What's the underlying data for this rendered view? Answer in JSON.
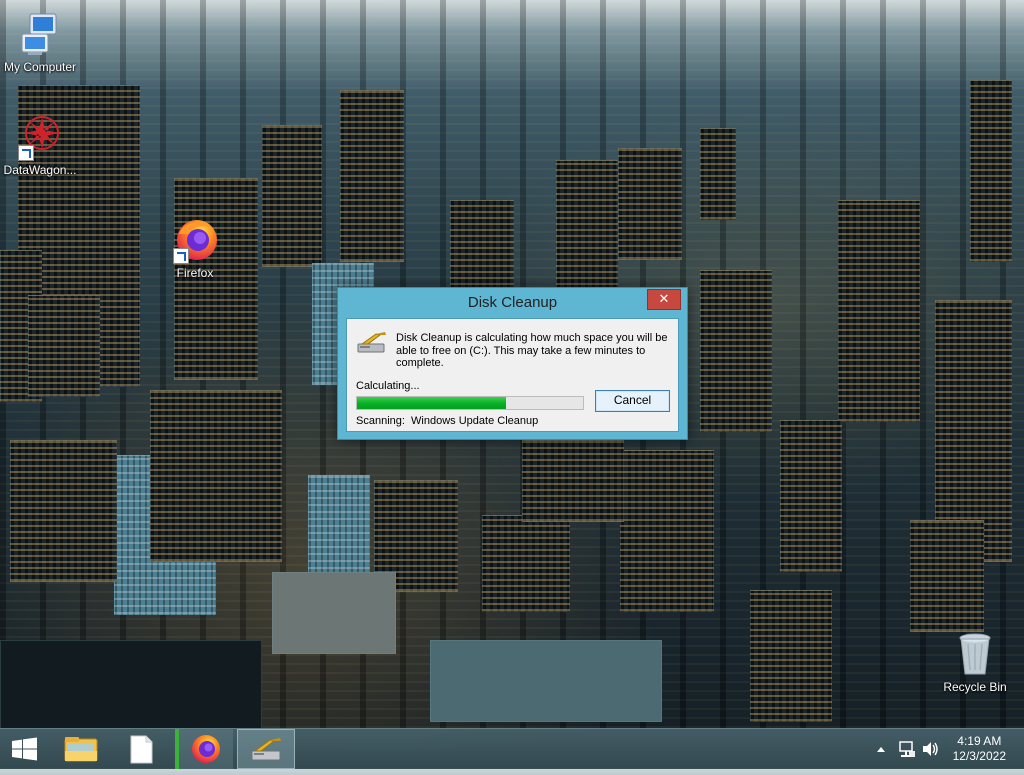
{
  "desktop": {
    "icons": [
      {
        "label": "My Computer"
      },
      {
        "label": "DataWagon..."
      },
      {
        "label": "Firefox"
      },
      {
        "label": "Recycle Bin"
      }
    ]
  },
  "dialog": {
    "title": "Disk Cleanup",
    "close_symbol": "✕",
    "message": "Disk Cleanup is calculating how much space you will be able to free on  (C:). This may take a few minutes to complete.",
    "status_label": "Calculating...",
    "progress_fraction": 0.66,
    "cancel_label": "Cancel",
    "scanning_text": "Scanning:  Windows Update Cleanup"
  },
  "taskbar": {
    "items": [
      {
        "name": "start-button",
        "icon": "windows-logo-icon"
      },
      {
        "name": "file-explorer",
        "icon": "folder-icon"
      },
      {
        "name": "blank-document",
        "icon": "document-icon"
      },
      {
        "name": "firefox",
        "icon": "firefox-icon"
      },
      {
        "name": "disk-cleanup",
        "icon": "disk-cleanup-icon"
      }
    ],
    "tray": {
      "time": "4:19 AM",
      "date": "12/3/2022"
    }
  },
  "colors": {
    "dialog_frame": "#5fb6d3",
    "close_button": "#c7483f",
    "progress_fill": "#06b025",
    "taskbar": "#3f5a63"
  }
}
